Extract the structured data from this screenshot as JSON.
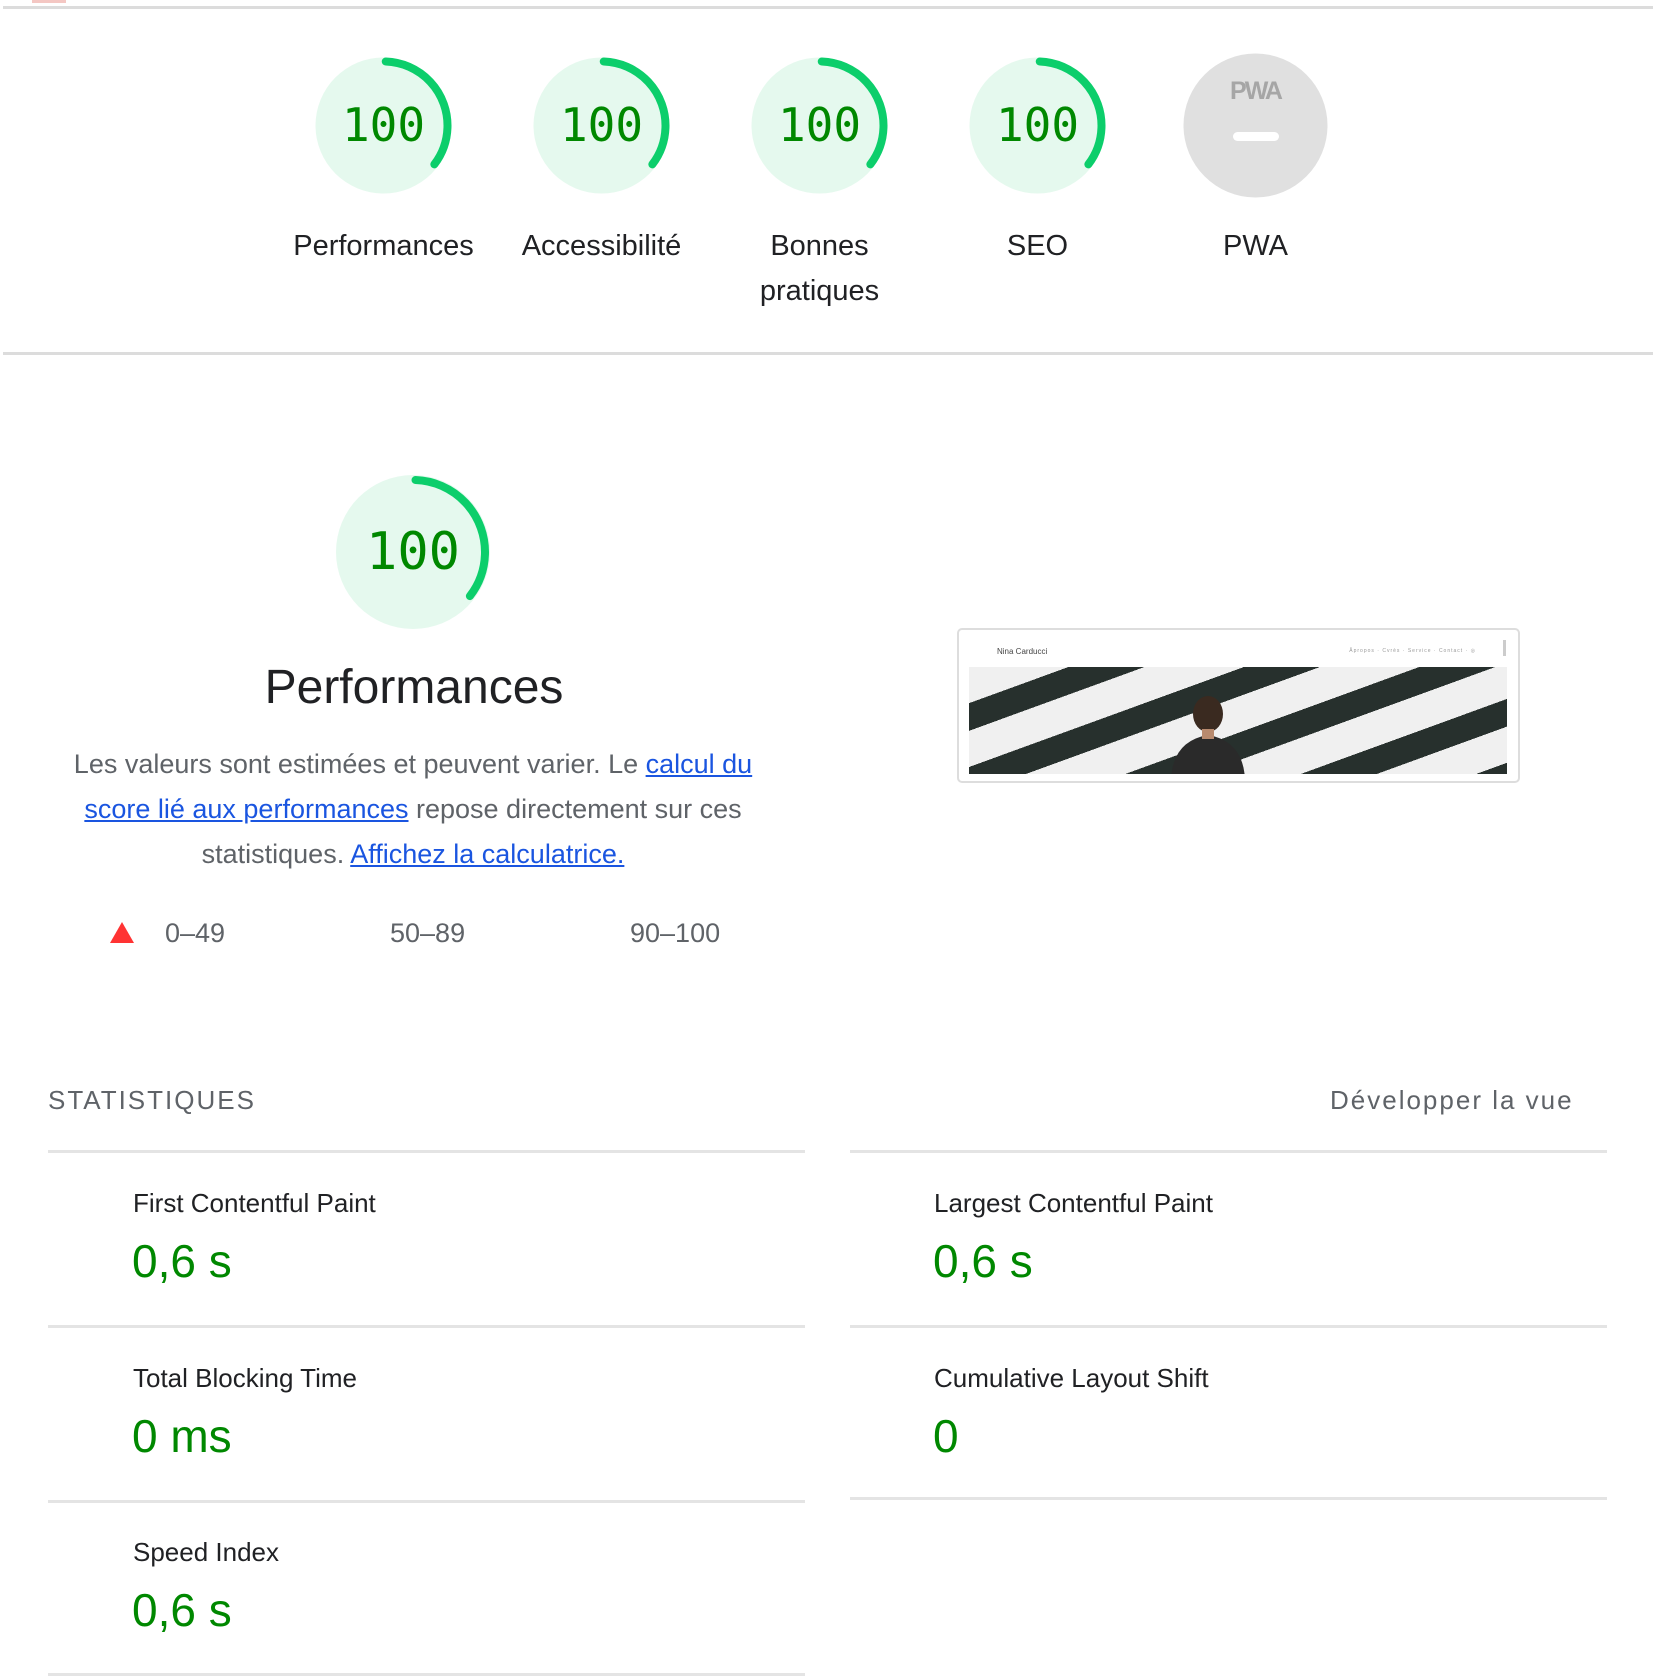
{
  "colors": {
    "pass": "#0cce6b",
    "pass_bg": "#e5f9ee",
    "pass_text": "#008800",
    "na_bg": "#e0e0e0",
    "fail": "#ff3333",
    "link": "#1a55e0"
  },
  "gauges": [
    {
      "score": "100",
      "label": "Performances",
      "value": 100
    },
    {
      "score": "100",
      "label": "Accessibilité",
      "value": 100
    },
    {
      "score": "100",
      "label": "Bonnes pratiques",
      "value": 100
    },
    {
      "score": "100",
      "label": "SEO",
      "value": 100
    },
    {
      "badge": "PWA",
      "label": "PWA"
    }
  ],
  "performance": {
    "score": "100",
    "title": "Performances",
    "desc_part1": "Les valeurs sont estimées et peuvent varier. Le ",
    "link_calc": "calcul du score lié aux performances",
    "desc_part2": " repose directement sur ces statistiques. ",
    "link_calculator": "Affichez la calculatrice.",
    "legend": [
      "0–49",
      "50–89",
      "90–100"
    ]
  },
  "screenshot": {
    "site_name": "Nina Carducci",
    "nav": "Âpropos · Cvrès · Service · Contact · ◎"
  },
  "stats": {
    "title": "STATISTIQUES",
    "toggle": "Développer la vue",
    "metrics": [
      {
        "label": "First Contentful Paint",
        "value": "0,6 s"
      },
      {
        "label": "Largest Contentful Paint",
        "value": "0,6 s"
      },
      {
        "label": "Total Blocking Time",
        "value": "0 ms"
      },
      {
        "label": "Cumulative Layout Shift",
        "value": "0"
      },
      {
        "label": "Speed Index",
        "value": "0,6 s"
      }
    ]
  }
}
